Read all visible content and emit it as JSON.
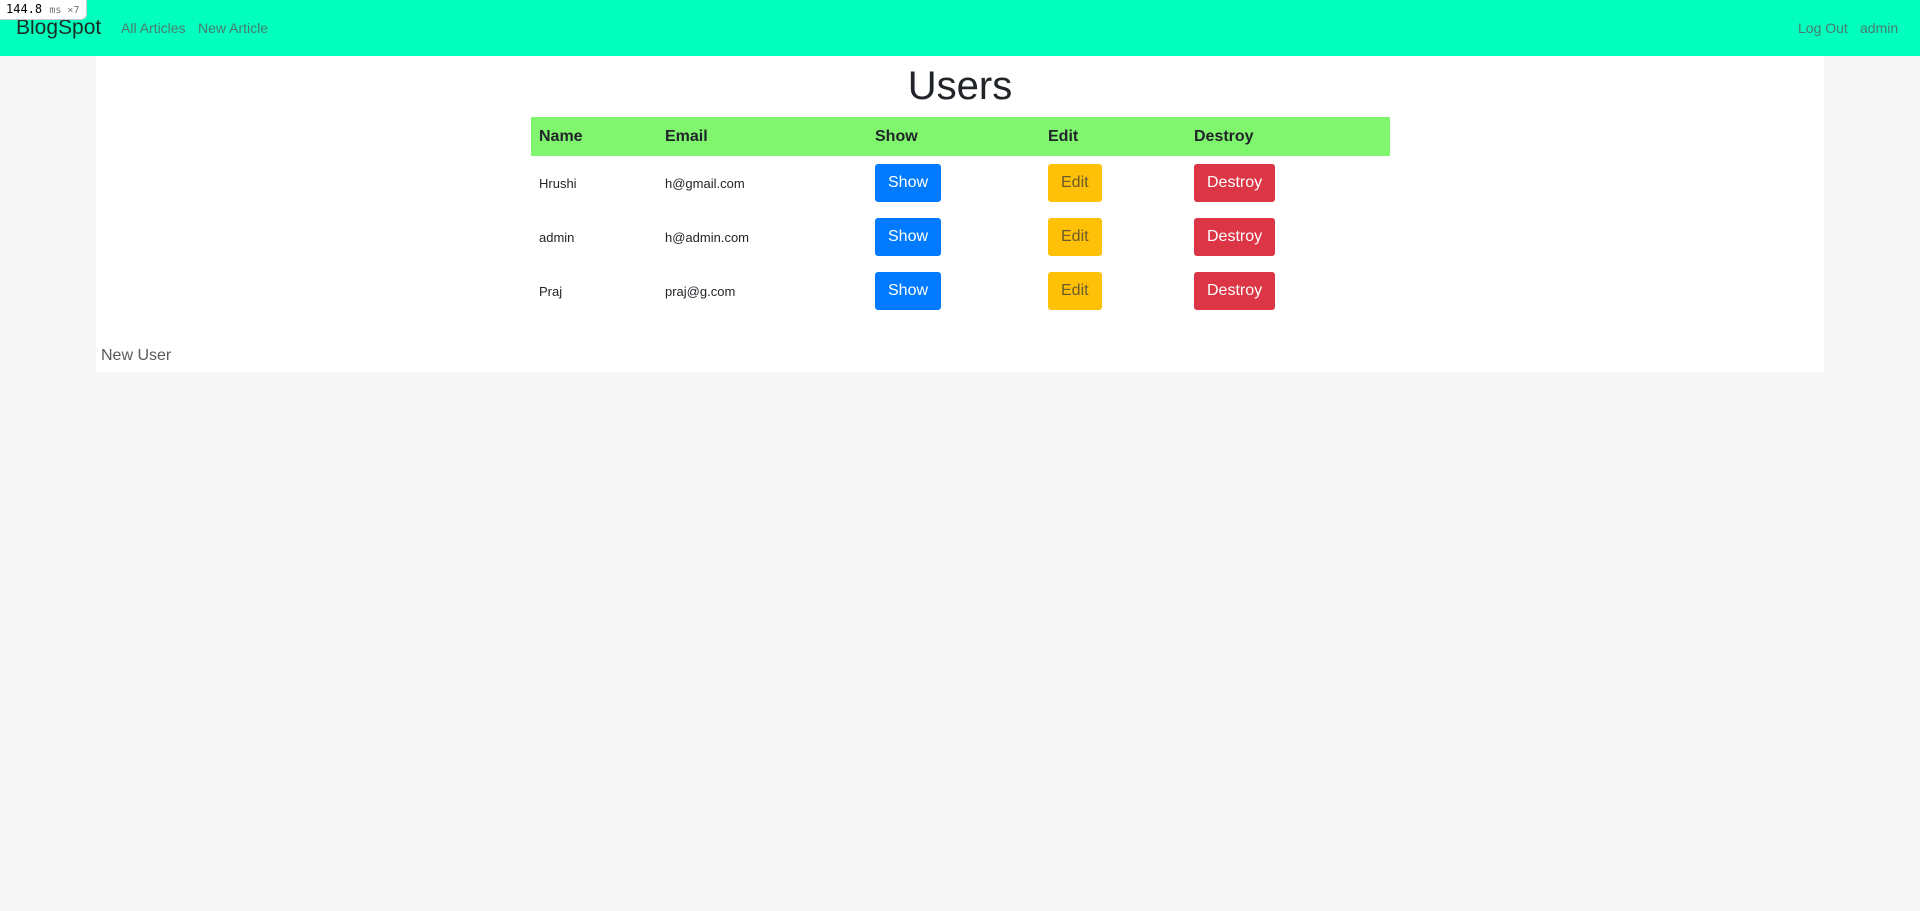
{
  "perf": {
    "value": "144.8",
    "unit": "ms ×7"
  },
  "navbar": {
    "brand": "BlogSpot",
    "links": [
      "All Articles",
      "New Article"
    ],
    "right": {
      "logout": "Log Out",
      "user": "admin"
    }
  },
  "page": {
    "title": "Users",
    "table": {
      "headers": [
        "Name",
        "Email",
        "Show",
        "Edit",
        "Destroy"
      ],
      "rows": [
        {
          "name": "Hrushi",
          "email": "h@gmail.com",
          "show": "Show",
          "edit": "Edit",
          "destroy": "Destroy"
        },
        {
          "name": "admin",
          "email": "h@admin.com",
          "show": "Show",
          "edit": "Edit",
          "destroy": "Destroy"
        },
        {
          "name": "Praj",
          "email": "praj@g.com",
          "show": "Show",
          "edit": "Edit",
          "destroy": "Destroy"
        }
      ]
    },
    "new_user": "New User"
  },
  "colors": {
    "navbar": "#03ffbd",
    "table_header": "#7ff66e",
    "show": "#007bff",
    "edit": "#ffc107",
    "destroy": "#dc3545"
  }
}
